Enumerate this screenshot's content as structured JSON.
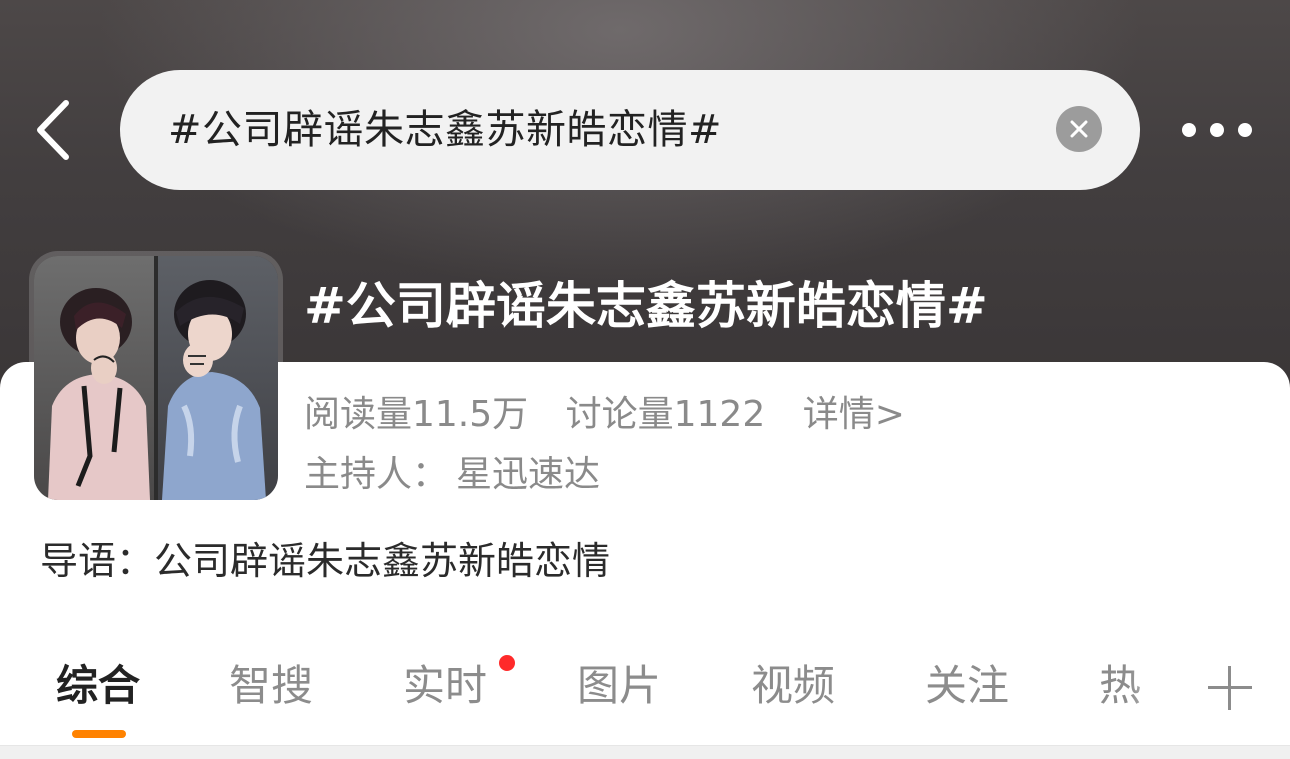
{
  "search": {
    "query": "#公司辟谣朱志鑫苏新皓恋情#"
  },
  "topic": {
    "title": "#公司辟谣朱志鑫苏新皓恋情#",
    "stats": {
      "reads": "阅读量11.5万",
      "discussions": "讨论量1122",
      "details_link": "详情>"
    },
    "host_label": "主持人：",
    "host_name": "星迅速达",
    "intro": "导语：公司辟谣朱志鑫苏新皓恋情"
  },
  "tabs": [
    {
      "label": "综合",
      "active": true
    },
    {
      "label": "智搜",
      "active": false
    },
    {
      "label": "实时",
      "active": false,
      "badge": "red-dot"
    },
    {
      "label": "图片",
      "active": false
    },
    {
      "label": "视频",
      "active": false
    },
    {
      "label": "关注",
      "active": false
    },
    {
      "label": "热",
      "active": false
    }
  ],
  "icons": {
    "back": "chevron-left-icon",
    "clear": "close-circle-icon",
    "more": "more-horizontal-icon",
    "add_tab": "plus-icon"
  },
  "colors": {
    "accent": "#ff8200",
    "badge": "#ff2a2a",
    "header_bg": "#423e3f",
    "muted_text": "#8a8a8a"
  }
}
